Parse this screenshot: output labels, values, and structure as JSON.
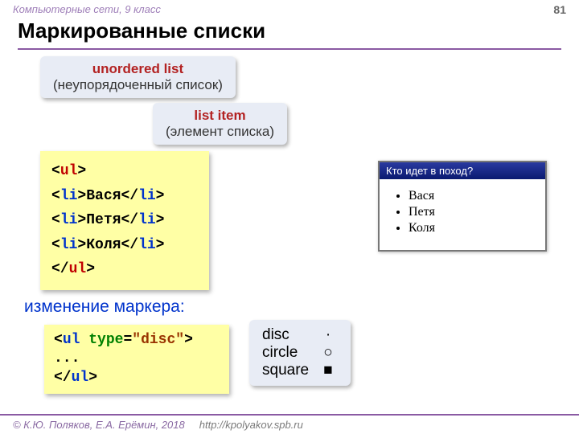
{
  "header": {
    "breadcrumb": "Компьютерные сети, 9 класс",
    "page": "81"
  },
  "title": "Маркированные списки",
  "callouts": {
    "ul": {
      "term": "unordered list",
      "trans": "(неупорядоченный список)"
    },
    "li": {
      "term": "list item",
      "trans": "(элемент списка)"
    }
  },
  "code_lines": [
    "<ul>",
    "<li>",
    "Вася",
    "</li>",
    "<li>",
    "Петя",
    "</li>",
    "<li>",
    "Коля",
    "</li>",
    "</ul>"
  ],
  "browser": {
    "title": "Кто идет в поход?",
    "items": [
      "Вася",
      "Петя",
      "Коля"
    ]
  },
  "subhead": "изменение маркера:",
  "code2": {
    "open_tag": "ul",
    "attr_name": "type",
    "attr_val": "\"disc\"",
    "body": "...",
    "close": "</ul>"
  },
  "markers": [
    {
      "name": "disc",
      "sym": "·"
    },
    {
      "name": "circle",
      "sym": "○"
    },
    {
      "name": "square",
      "sym": "■"
    }
  ],
  "footer": {
    "copy": "© К.Ю. Поляков, Е.А. Ерёмин, 2018",
    "link": "http://kpolyakov.spb.ru"
  }
}
